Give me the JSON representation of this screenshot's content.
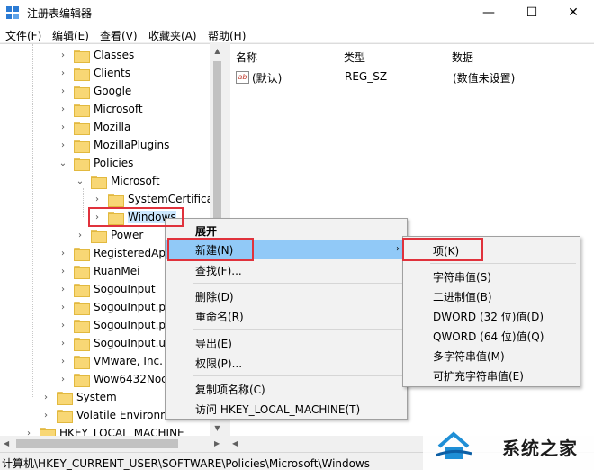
{
  "window": {
    "title": "注册表编辑器",
    "minimize": "—",
    "maximize": "☐",
    "close": "✕"
  },
  "menu": [
    "文件(F)",
    "编辑(E)",
    "查看(V)",
    "收藏夹(A)",
    "帮助(H)"
  ],
  "tree": [
    {
      "label": "Classes",
      "arrow": "›"
    },
    {
      "label": "Clients",
      "arrow": "›"
    },
    {
      "label": "Google",
      "arrow": "›"
    },
    {
      "label": "Microsoft",
      "arrow": "›"
    },
    {
      "label": "Mozilla",
      "arrow": "›"
    },
    {
      "label": "MozillaPlugins",
      "arrow": "›"
    },
    {
      "label": "Policies",
      "arrow": "⌄"
    },
    {
      "label": "Microsoft",
      "arrow": "⌄"
    },
    {
      "label": "SystemCertificat",
      "arrow": "›"
    },
    {
      "label": "Windows",
      "arrow": "›"
    },
    {
      "label": "Power",
      "arrow": "›"
    },
    {
      "label": "RegisteredAp",
      "arrow": "›"
    },
    {
      "label": "RuanMei",
      "arrow": "›"
    },
    {
      "label": "SogouInput",
      "arrow": "›"
    },
    {
      "label": "SogouInput.p",
      "arrow": "›"
    },
    {
      "label": "SogouInput.p",
      "arrow": "›"
    },
    {
      "label": "SogouInput.u",
      "arrow": "›"
    },
    {
      "label": "VMware, Inc.",
      "arrow": "›"
    },
    {
      "label": "Wow6432Noc",
      "arrow": "›"
    },
    {
      "label": "System",
      "arrow": "›"
    },
    {
      "label": "Volatile Environm",
      "arrow": "›"
    },
    {
      "label": "HKEY_LOCAL_MACHINE",
      "arrow": "›"
    }
  ],
  "list": {
    "headers": {
      "name": "名称",
      "type": "类型",
      "data": "数据"
    },
    "rows": [
      {
        "name": "(默认)",
        "type": "REG_SZ",
        "data": "(数值未设置)"
      }
    ]
  },
  "context_menu": {
    "items": [
      "展开",
      "新建(N)",
      "查找(F)...",
      "删除(D)",
      "重命名(R)",
      "导出(E)",
      "权限(P)...",
      "复制项名称(C)",
      "访问 HKEY_LOCAL_MACHINE(T)"
    ],
    "submenu_arrow": "›"
  },
  "submenu": {
    "items": [
      "项(K)",
      "字符串值(S)",
      "二进制值(B)",
      "DWORD (32 位)值(D)",
      "QWORD (64 位)值(Q)",
      "多字符串值(M)",
      "可扩充字符串值(E)"
    ]
  },
  "status": "计算机\\HKEY_CURRENT_USER\\SOFTWARE\\Policies\\Microsoft\\Windows",
  "watermark": {
    "text": "系统之家"
  },
  "colors": {
    "highlight": "#91c9f7",
    "annotation": "#e0323c",
    "folder": "#f8d775"
  }
}
